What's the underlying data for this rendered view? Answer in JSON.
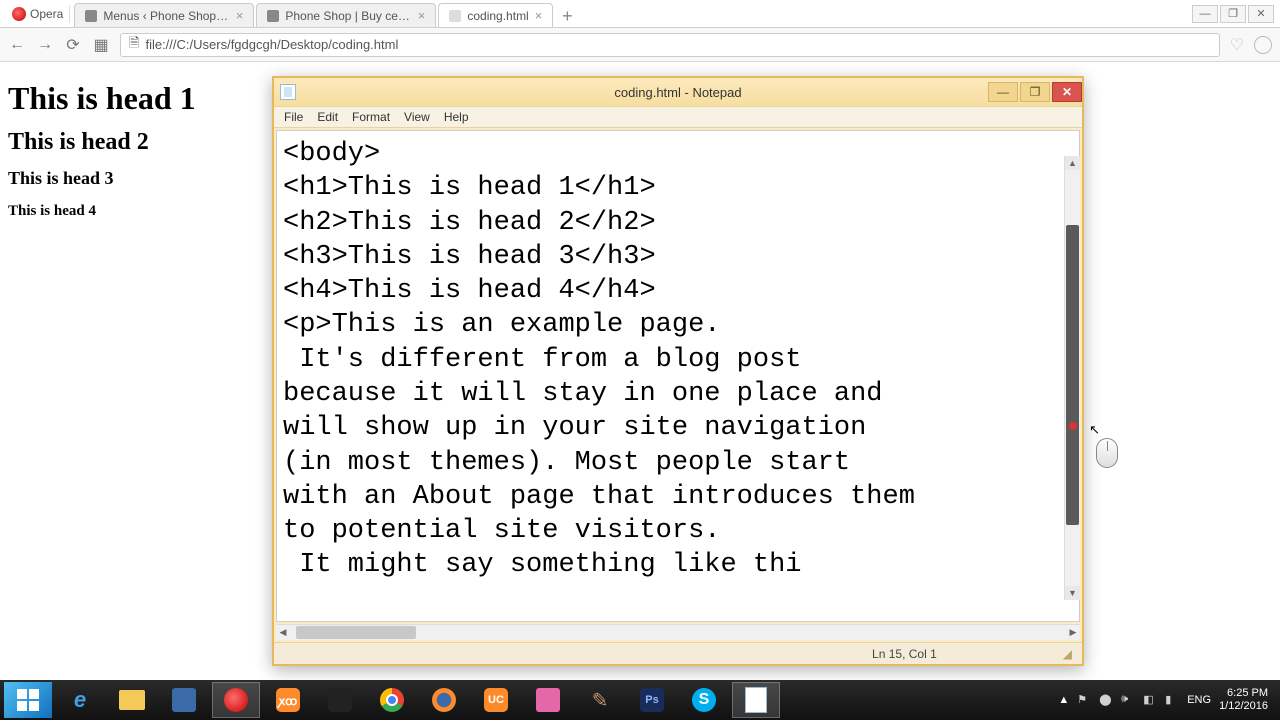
{
  "browser": {
    "name": "Opera",
    "tabs": [
      {
        "label": "Menus ‹ Phone Shop — W…"
      },
      {
        "label": "Phone Shop | Buy cell ph…"
      },
      {
        "label": "coding.html",
        "active": true
      }
    ],
    "url": "file:///C:/Users/fgdgcgh/Desktop/coding.html",
    "win": {
      "min": "—",
      "max": "❐",
      "close": "✕"
    }
  },
  "page": {
    "h1": "This is head 1",
    "h2": "This is head 2",
    "h3": "This is head 3",
    "h4": "This is head 4"
  },
  "notepad": {
    "title": "coding.html - Notepad",
    "menu": [
      "File",
      "Edit",
      "Format",
      "View",
      "Help"
    ],
    "content": "<body>\n<h1>This is head 1</h1>\n<h2>This is head 2</h2>\n<h3>This is head 3</h3>\n<h4>This is head 4</h4>\n<p>This is an example page.\n It's different from a blog post \nbecause it will stay in one place and \nwill show up in your site navigation \n(in most themes). Most people start \nwith an About page that introduces them \nto potential site visitors.\n It might say something like thi",
    "status": "Ln 15, Col 1",
    "win": {
      "min": "—",
      "max": "❐",
      "close": "✕"
    }
  },
  "taskbar": {
    "xampp": "ꭗꝏ",
    "uc": "UC",
    "ps": "Ps",
    "skype": "S",
    "upIcon": "▲",
    "lang": "ENG",
    "clock": {
      "time": "6:25 PM",
      "date": "1/12/2016"
    }
  }
}
